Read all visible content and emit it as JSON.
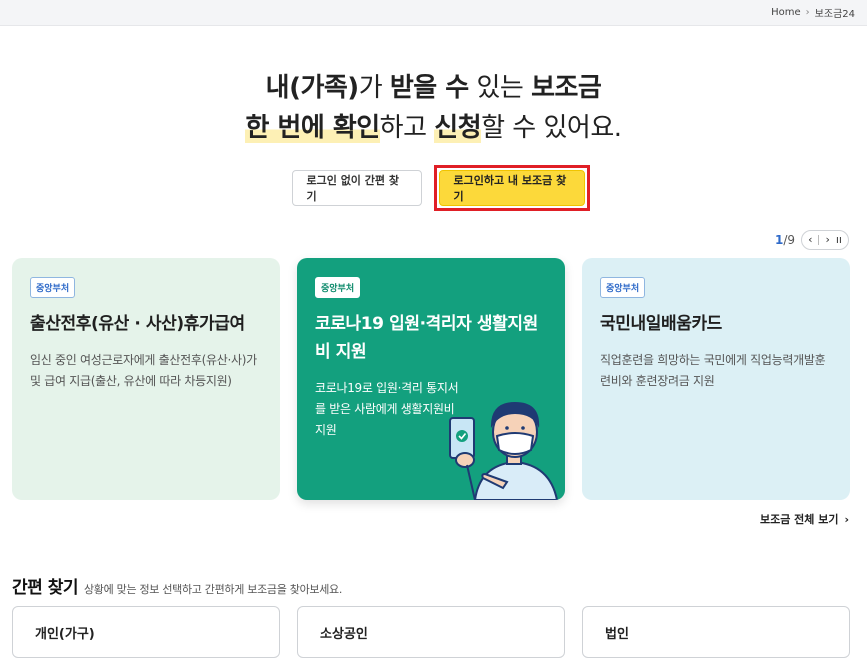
{
  "breadcrumb": {
    "home": "Home",
    "separator": "›",
    "current": "보조금24"
  },
  "hero": {
    "line1": {
      "a": "내(가족)",
      "b": "가 ",
      "c": "받을 수",
      "d": " 있는 ",
      "e": "보조금"
    },
    "line2": {
      "a": "한 번에 확인",
      "b": "하고 ",
      "c": "신청",
      "d": "할 수 있어요."
    }
  },
  "buttons": {
    "guest_search": "로그인 없이 간편 찾기",
    "login_search": "로그인하고 내 보조금 찾기"
  },
  "pager": {
    "current": "1",
    "total": "/9",
    "prev": "‹",
    "next": "›",
    "pause": "ıı"
  },
  "cards": [
    {
      "tag": "중앙부처",
      "title": "출산전후(유산 · 사산)휴가급여",
      "desc": "임신 중인 여성근로자에게 출산전후(유산·사)가 및 급여 지급(출산, 유산에 따라 차등지원)"
    },
    {
      "tag": "중앙부처",
      "title": "코로나19 입원·격리자 생활지원비 지원",
      "desc": "코로나19로 입원·격리 통지서를 받은 사람에게 생활지원비 지원"
    },
    {
      "tag": "중앙부처",
      "title": "국민내일배움카드",
      "desc": "직업훈련을 희망하는 국민에게 직업능력개발훈련비와 훈련장려금 지원"
    }
  ],
  "view_all": {
    "label": "보조금 전체 보기",
    "arrow": "›"
  },
  "quick": {
    "title": "간편 찾기",
    "subtitle": "상황에 맞는 정보 선택하고 간편하게 보조금을 찾아보세요.",
    "choices": [
      "개인(가구)",
      "소상공인",
      "법인"
    ]
  },
  "colors": {
    "accent_yellow": "#fcd93a",
    "highlight_red": "#e01f26",
    "card_green": "#13a07e",
    "card_mint": "#e5f3ea",
    "card_sky": "#dcf0f5"
  }
}
